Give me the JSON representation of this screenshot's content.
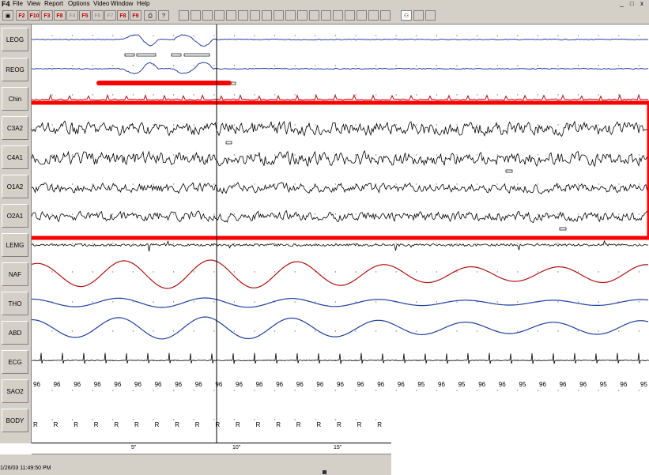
{
  "app": {
    "name": "F4"
  },
  "menu": [
    "File",
    "View",
    "Report",
    "Options",
    "Video",
    "Window",
    "Help"
  ],
  "window_controls": [
    "_",
    "□",
    "x"
  ],
  "toolbar": {
    "fkeys": [
      {
        "label": "F2",
        "style": "red"
      },
      {
        "label": "F10",
        "style": "red"
      },
      {
        "label": "F3",
        "style": "red"
      },
      {
        "label": "F8",
        "style": "red"
      },
      {
        "label": "F4",
        "style": "gray"
      },
      {
        "label": "F5",
        "style": "red"
      },
      {
        "label": "F6",
        "style": "gray"
      },
      {
        "label": "F7",
        "style": "gray"
      },
      {
        "label": "F8",
        "style": "red"
      },
      {
        "label": "F9",
        "style": "red"
      }
    ]
  },
  "channels": [
    "LEOG",
    "REOG",
    "Chin",
    "C3A2",
    "C4A1",
    "O1A2",
    "O2A1",
    "LEMG",
    "NAF",
    "THO",
    "ABD",
    "ECG",
    "SAO2",
    "BODY"
  ],
  "sao2_values": [
    "96",
    "96",
    "96",
    "96",
    "96",
    "96",
    "96",
    "96",
    "96",
    "96",
    "96",
    "96",
    "96",
    "96",
    "96",
    "96",
    "96",
    "96",
    "96",
    "95",
    "96",
    "95",
    "96",
    "96",
    "95",
    "96",
    "96",
    "96",
    "95",
    "96",
    "95"
  ],
  "body_values": [
    "R",
    "R",
    "R",
    "R",
    "R",
    "R",
    "R",
    "R",
    "R",
    "R",
    "R",
    "R",
    "R",
    "R",
    "R",
    "R",
    "R",
    "R"
  ],
  "time_ticks": [
    "5\"",
    "10\"",
    "15\""
  ],
  "status": {
    "datetime": "1/26/03 11:49:50 PM"
  },
  "colors": {
    "eog": "#2a3fa0",
    "eeg": "#000000",
    "chin": "#b01010",
    "naf": "#b01010",
    "effort": "#1f3f9f",
    "highlight": "#ff0000",
    "grid": "#808080"
  }
}
